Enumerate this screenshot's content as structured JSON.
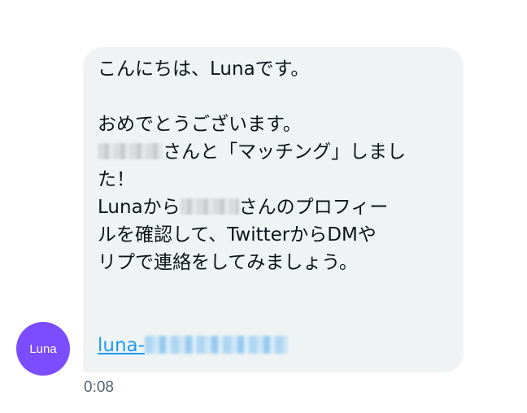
{
  "message": {
    "lines": {
      "l1": "こんにちは、Lunaです。",
      "l3": "おめでとうございます。",
      "l4_suffix": "さんと「マッチング」しまし",
      "l5": "た！",
      "l6_prefix": "Lunaから",
      "l6_suffix": "さんのプロフィー",
      "l7": "ルを確認して、TwitterからDMや",
      "l8": "リプで連絡をしてみましょう。"
    },
    "link_prefix": "luna-"
  },
  "avatar": {
    "label": "Luna",
    "color": "#7b4dff"
  },
  "timestamp": "0:08",
  "colors": {
    "bubble": "#eff3f4",
    "link": "#1d9bf0",
    "text": "#0f1419",
    "muted": "#536471"
  }
}
